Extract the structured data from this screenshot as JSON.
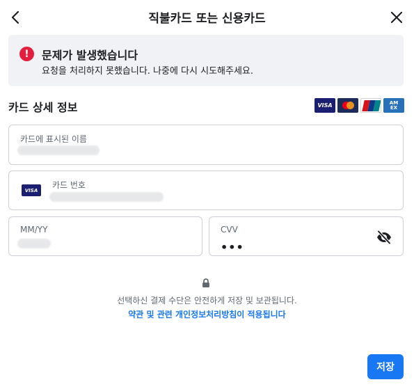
{
  "header": {
    "title": "직불카드 또는 신용카드",
    "back_icon": "chevron-left-icon",
    "close_icon": "close-icon"
  },
  "error": {
    "icon": "!",
    "title": "문제가 발생했습니다",
    "message": "요청을 처리하지 못했습니다. 나중에 다시 시도해주세요."
  },
  "card_details": {
    "title": "카드 상세 정보",
    "brands": [
      "VISA",
      "MasterCard",
      "UnionPay",
      "AMEX"
    ]
  },
  "fields": {
    "name_label": "카드에 표시된 이름",
    "number_label": "카드 번호",
    "number_brand": "VISA",
    "expiry_label": "MM/YY",
    "cvv_label": "CVV",
    "cvv_value": "•••"
  },
  "footer": {
    "secure_text": "선택하신 결제 수단은 안전하게 저장 및 보관됩니다.",
    "terms_link": "약관 및 관련 개인정보처리방침이 적용됩니다",
    "save_label": "저장"
  },
  "colors": {
    "accent": "#1877f2",
    "error": "#e41e3f",
    "error_bg": "#f0f2f5"
  }
}
